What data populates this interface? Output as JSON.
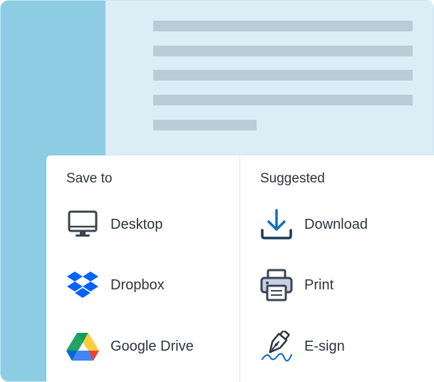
{
  "save_to": {
    "title": "Save to",
    "items": [
      {
        "label": "Desktop",
        "icon": "desktop-monitor-icon"
      },
      {
        "label": "Dropbox",
        "icon": "dropbox-icon"
      },
      {
        "label": "Google Drive",
        "icon": "google-drive-icon"
      }
    ]
  },
  "suggested": {
    "title": "Suggested",
    "items": [
      {
        "label": "Download",
        "icon": "download-icon"
      },
      {
        "label": "Print",
        "icon": "printer-icon"
      },
      {
        "label": "E-sign",
        "icon": "pen-signature-icon"
      }
    ]
  },
  "colors": {
    "sidebar": "#8ccde4",
    "document_bg": "#dbeef6",
    "placeholder_lines": "#b9cdd6",
    "accent": "#1a6fb5",
    "text": "#2d3440"
  }
}
